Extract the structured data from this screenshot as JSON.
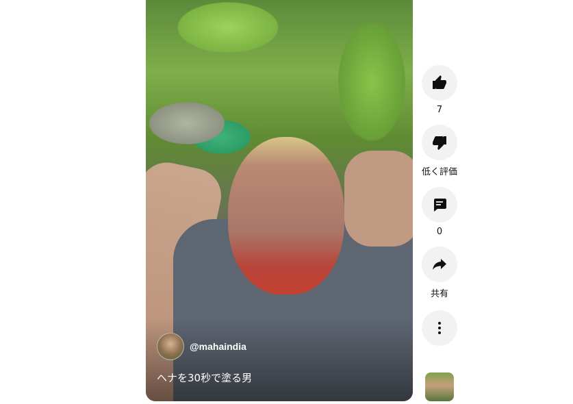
{
  "video": {
    "channel_handle": "@mahaindia",
    "caption": "ヘナを30秒で塗る男"
  },
  "actions": {
    "like_count": "7",
    "dislike_label": "低く評価",
    "comment_count": "0",
    "share_label": "共有"
  },
  "icons": {
    "like": "thumbs-up-icon",
    "dislike": "thumbs-down-icon",
    "comment": "comment-icon",
    "share": "share-arrow-icon",
    "more": "more-vertical-icon"
  }
}
